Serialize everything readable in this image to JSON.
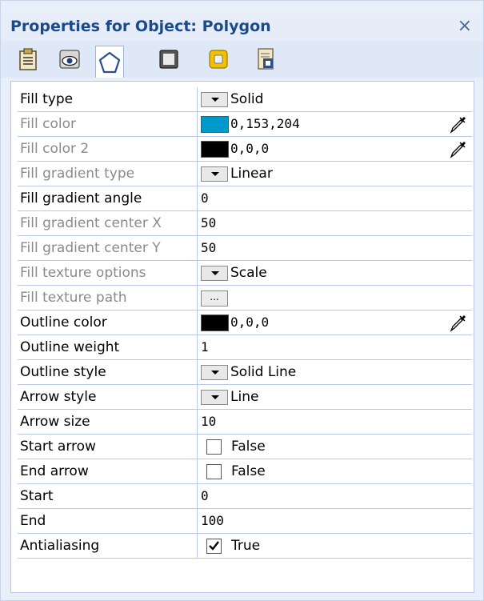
{
  "window": {
    "title": "Properties for Object: Polygon",
    "close_symbol": "×"
  },
  "toolbar": {
    "tabs": [
      {
        "icon": "clipboard-icon",
        "active": false
      },
      {
        "icon": "eye-icon",
        "active": false
      },
      {
        "icon": "pentagon-icon",
        "active": true
      },
      {
        "icon": "frame-icon",
        "active": false
      },
      {
        "icon": "layer-icon",
        "active": false
      },
      {
        "icon": "document-settings-icon",
        "active": false
      }
    ]
  },
  "properties": [
    {
      "name": "Fill type",
      "enabled": true,
      "editor": "dropdown",
      "value": "Solid"
    },
    {
      "name": "Fill color",
      "enabled": false,
      "editor": "color",
      "value": "0,153,204",
      "color": "#0099cc"
    },
    {
      "name": "Fill color 2",
      "enabled": false,
      "editor": "color",
      "value": "0,0,0",
      "color": "#000000"
    },
    {
      "name": "Fill gradient type",
      "enabled": false,
      "editor": "dropdown",
      "value": "Linear"
    },
    {
      "name": "Fill gradient angle",
      "enabled": true,
      "editor": "text",
      "value": "0"
    },
    {
      "name": "Fill gradient center X",
      "enabled": false,
      "editor": "text",
      "value": "50"
    },
    {
      "name": "Fill gradient center Y",
      "enabled": false,
      "editor": "text",
      "value": "50"
    },
    {
      "name": "Fill texture options",
      "enabled": false,
      "editor": "dropdown",
      "value": "Scale"
    },
    {
      "name": "Fill texture path",
      "enabled": false,
      "editor": "browse",
      "value": "..."
    },
    {
      "name": "Outline color",
      "enabled": true,
      "editor": "color",
      "value": "0,0,0",
      "color": "#000000"
    },
    {
      "name": "Outline weight",
      "enabled": true,
      "editor": "text",
      "value": "1"
    },
    {
      "name": "Outline style",
      "enabled": true,
      "editor": "dropdown",
      "value": "Solid Line"
    },
    {
      "name": "Arrow style",
      "enabled": true,
      "editor": "dropdown",
      "value": "Line"
    },
    {
      "name": "Arrow size",
      "enabled": true,
      "editor": "text",
      "value": "10"
    },
    {
      "name": "Start arrow",
      "enabled": true,
      "editor": "checkbox",
      "value": "False",
      "checked": false
    },
    {
      "name": "End arrow",
      "enabled": true,
      "editor": "checkbox",
      "value": "False",
      "checked": false
    },
    {
      "name": "Start",
      "enabled": true,
      "editor": "text",
      "value": "0"
    },
    {
      "name": "End",
      "enabled": true,
      "editor": "text",
      "value": "100"
    },
    {
      "name": "Antialiasing",
      "enabled": true,
      "editor": "checkbox",
      "value": "True",
      "checked": true
    }
  ],
  "colors": {
    "title_text": "#1a4a8c",
    "grid_line": "#b9c8e6",
    "panel_bg": "#e9eff8"
  }
}
